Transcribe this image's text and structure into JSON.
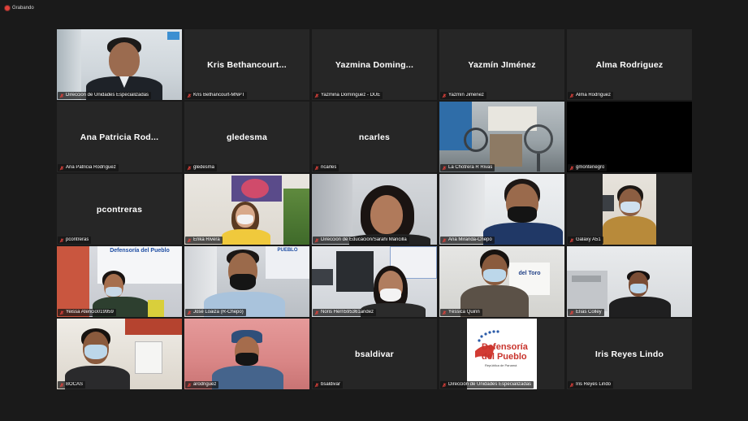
{
  "recording": {
    "label": "Grabando"
  },
  "participants": [
    {
      "label": "Dirección de Unidades Especializadas"
    },
    {
      "name": "Kris  Bethancourt...",
      "label": "Kris Bethancourt-MNPT"
    },
    {
      "name": "Yazmina  Doming...",
      "label": "Yazmina Domínguez - DUE"
    },
    {
      "name": "Yazmín JIménez",
      "label": "Yazmín Jiménez"
    },
    {
      "name": "Alma Rodriguez",
      "label": "Alma Rodríguez"
    },
    {
      "name": "Ana  Patricia  Rod...",
      "label": "Ana Patricia Rodríguez"
    },
    {
      "name": "gledesma",
      "label": "gledesma"
    },
    {
      "name": "ncarles",
      "label": "ncarles"
    },
    {
      "label": "La Chotrera R Rivas"
    },
    {
      "label": "gmontenegro"
    },
    {
      "name": "pcontreras",
      "label": "pcontreras"
    },
    {
      "label": "Erika Rivera"
    },
    {
      "label": "Dirección de Educación/Sarahi Mancilla"
    },
    {
      "label": "Ana Miranda-Chepo"
    },
    {
      "label": "Galaxy A51"
    },
    {
      "label": "Yeissa Atencio019959"
    },
    {
      "label": "José Loaiza (R-Chepo)"
    },
    {
      "label": "Noris Hern595361andez"
    },
    {
      "label": "Yéssica Quinn"
    },
    {
      "label": "Elías Colley"
    },
    {
      "label": "BOCAS"
    },
    {
      "label": "arodriguez"
    },
    {
      "name": "bsaldivar",
      "label": "bsaldivar"
    },
    {
      "label": "Dirección de Unidades Especializadas"
    },
    {
      "name": "Iris Reyes Lindo",
      "label": "Iris Reyes Lindo"
    }
  ],
  "banners": {
    "defensoria_1": "Defensoría del Pueblo",
    "defensoria_2": "PUEBLO",
    "del_toro": "del Toro",
    "logo_line1": "Defensoría",
    "logo_line2": "del Pueblo",
    "logo_sub": "República de Panamá"
  },
  "colors": {
    "active_border": "#c6e04a",
    "mic_muted": "#e0413a",
    "background": "#1a1a1a",
    "tile": "#262626"
  }
}
